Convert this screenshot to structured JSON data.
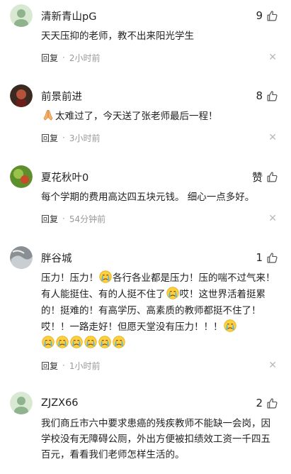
{
  "comments": [
    {
      "username": "清新青山pG",
      "likes": "9",
      "text": "天天压抑的老师，教不出来阳光学生",
      "reply_label": "回复",
      "separator": "·",
      "time": "2小时前"
    },
    {
      "username": "前景前进",
      "likes": "8",
      "text_emoji": "pray-emoji",
      "text": "太难过了，今天送了张老师最后一程！",
      "reply_label": "回复",
      "separator": "·",
      "time": "3小时前"
    },
    {
      "username": "夏花秋叶0",
      "likes": "赞",
      "text": "每个学期的费用高达四五块元钱。 细心一点多好。",
      "reply_label": "回复",
      "separator": "·",
      "time": "54分钟前"
    },
    {
      "username": "胖谷城",
      "likes": "1",
      "text_part1": "压力！压力！",
      "text_part2": "各行各业都是压力！压的喘不过气来！有人能挺住、有的人挺不住了",
      "text_part3": "哎！这世界活着挺累的！挺难的！有高学历、高素质的教师都挺不住了！哎！！一路走好！但愿天堂没有压力！！！",
      "emoji_icon": "crying-emoji",
      "reply_label": "回复",
      "separator": "·",
      "time": "1小时前"
    },
    {
      "username": "ZJZX66",
      "likes": "2",
      "text": "我们商丘市六中要求患癌的残疾教师不能缺一会岗，因学校没有无障碍公厕，外出方便被扣绩效工资一千四五百元，看看我们老师怎样生活的。",
      "reply_label": "回复",
      "separator": "·",
      "time": "2小时前"
    }
  ],
  "colors": {
    "accent_text": "#222222",
    "meta_text": "#999999",
    "close_icon": "#b8b8b8"
  },
  "icons": {
    "like": "thumbs-up-icon",
    "close": "close-icon"
  }
}
